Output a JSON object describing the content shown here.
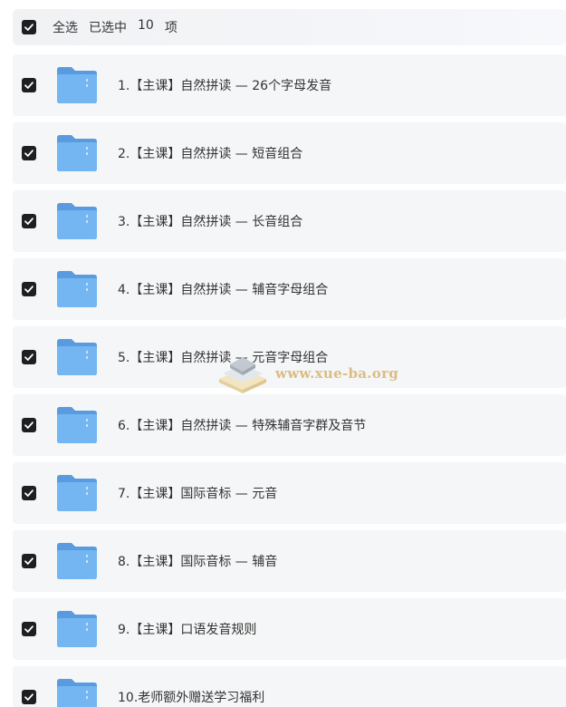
{
  "header": {
    "select_all_label": "全选",
    "selected_prefix": "已选中",
    "selected_count": "10",
    "selected_suffix": "项"
  },
  "items": [
    {
      "label": "1.【主课】自然拼读 — 26个字母发音"
    },
    {
      "label": "2.【主课】自然拼读 — 短音组合"
    },
    {
      "label": "3.【主课】自然拼读 — 长音组合"
    },
    {
      "label": "4.【主课】自然拼读 — 辅音字母组合"
    },
    {
      "label": "5.【主课】自然拼读 — 元音字母组合"
    },
    {
      "label": "6.【主课】自然拼读 — 特殊辅音字群及音节"
    },
    {
      "label": "7.【主课】国际音标 — 元音"
    },
    {
      "label": "8.【主课】国际音标 — 辅音"
    },
    {
      "label": "9.【主课】口语发音规则"
    },
    {
      "label": "10.老师额外赠送学习福利"
    }
  ],
  "watermark": {
    "text": "www.xue-ba.org"
  },
  "colors": {
    "row_bg": "#f5f6f7",
    "checkbox": "#1f1f1f",
    "folder_front": "#74b6f2",
    "folder_back": "#5a9be0",
    "text": "#333333"
  }
}
